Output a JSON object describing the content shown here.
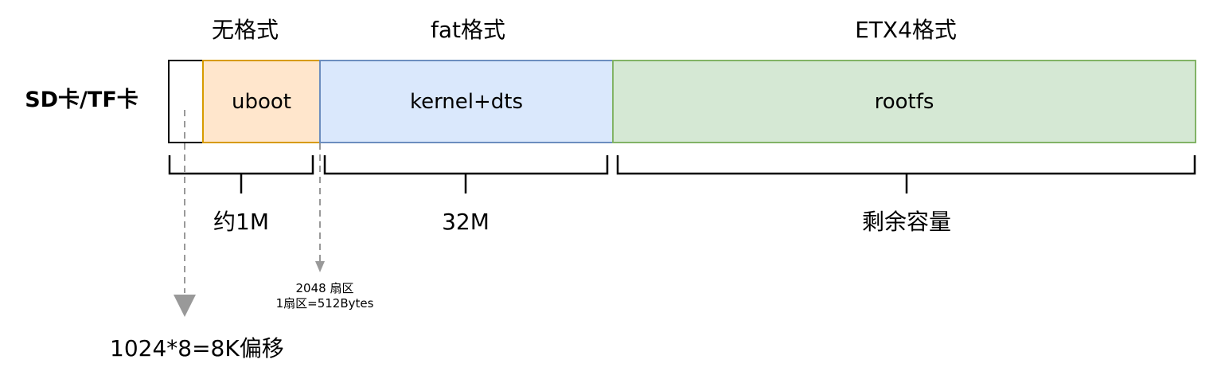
{
  "headers": {
    "raw": "无格式",
    "fat": "fat格式",
    "ext4": "ETX4格式"
  },
  "device": {
    "label": "SD卡/TF卡"
  },
  "segments": {
    "uboot": "uboot",
    "kernel": "kernel+dts",
    "rootfs": "rootfs"
  },
  "sizes": {
    "uboot": "约1M",
    "kernel": "32M",
    "rootfs": "剩余容量"
  },
  "annotations": {
    "sector_line1": "2048 扇区",
    "sector_line2": "1扇区=512Bytes",
    "offset": "1024*8=8K偏移"
  },
  "colors": {
    "uboot_fill": "#ffe6cc",
    "uboot_stroke": "#d79b00",
    "kernel_fill": "#dae8fc",
    "kernel_stroke": "#6c8ebf",
    "rootfs_fill": "#d5e8d4",
    "rootfs_stroke": "#82b366",
    "dashed_arrow": "#999999"
  }
}
